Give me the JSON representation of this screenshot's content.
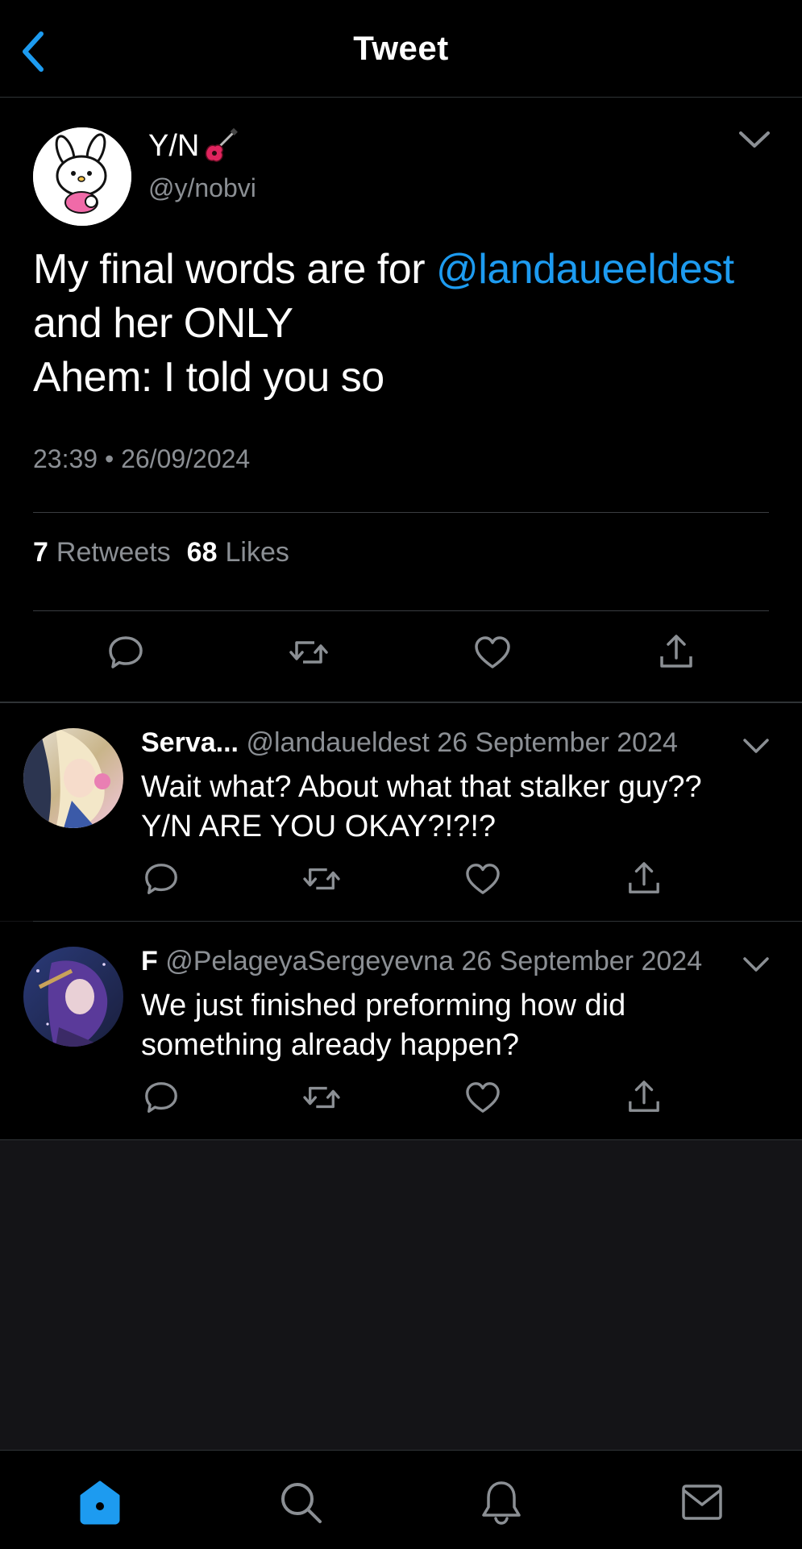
{
  "header": {
    "title": "Tweet"
  },
  "main_tweet": {
    "author_name": "Y/N",
    "author_handle": "@y/nobvi",
    "text_line1_prefix": "My final words are for ",
    "mention": "@landaueeldest",
    "text_line2": "and her ONLY",
    "text_line3": "Ahem: I told you so",
    "timestamp": "23:39 • 26/09/2024",
    "retweets_count": "7",
    "retweets_label": "Retweets",
    "likes_count": "68",
    "likes_label": "Likes"
  },
  "replies": [
    {
      "author": "Serva...",
      "handle": "@landaueldest",
      "date": "26 September 2024",
      "text_line1": "Wait what? About what that stalker guy??",
      "text_line2": "Y/N ARE YOU OKAY?!?!?"
    },
    {
      "author": "F",
      "handle": "@PelageyaSergeyevna",
      "date": "26 September 2024",
      "text_line1": "We just finished preforming how did",
      "text_line2": "something already happen?"
    }
  ],
  "icons": {
    "back": "chevron-left-icon",
    "more": "chevron-down-icon",
    "reply": "speech-bubble-icon",
    "retweet": "retweet-icon",
    "like": "heart-icon",
    "share": "share-icon",
    "home": "home-icon",
    "search": "search-icon",
    "notifications": "bell-icon",
    "messages": "mail-icon"
  },
  "colors": {
    "accent": "#1d9bf0",
    "background": "#000000",
    "secondary_text": "#8b8f94"
  }
}
